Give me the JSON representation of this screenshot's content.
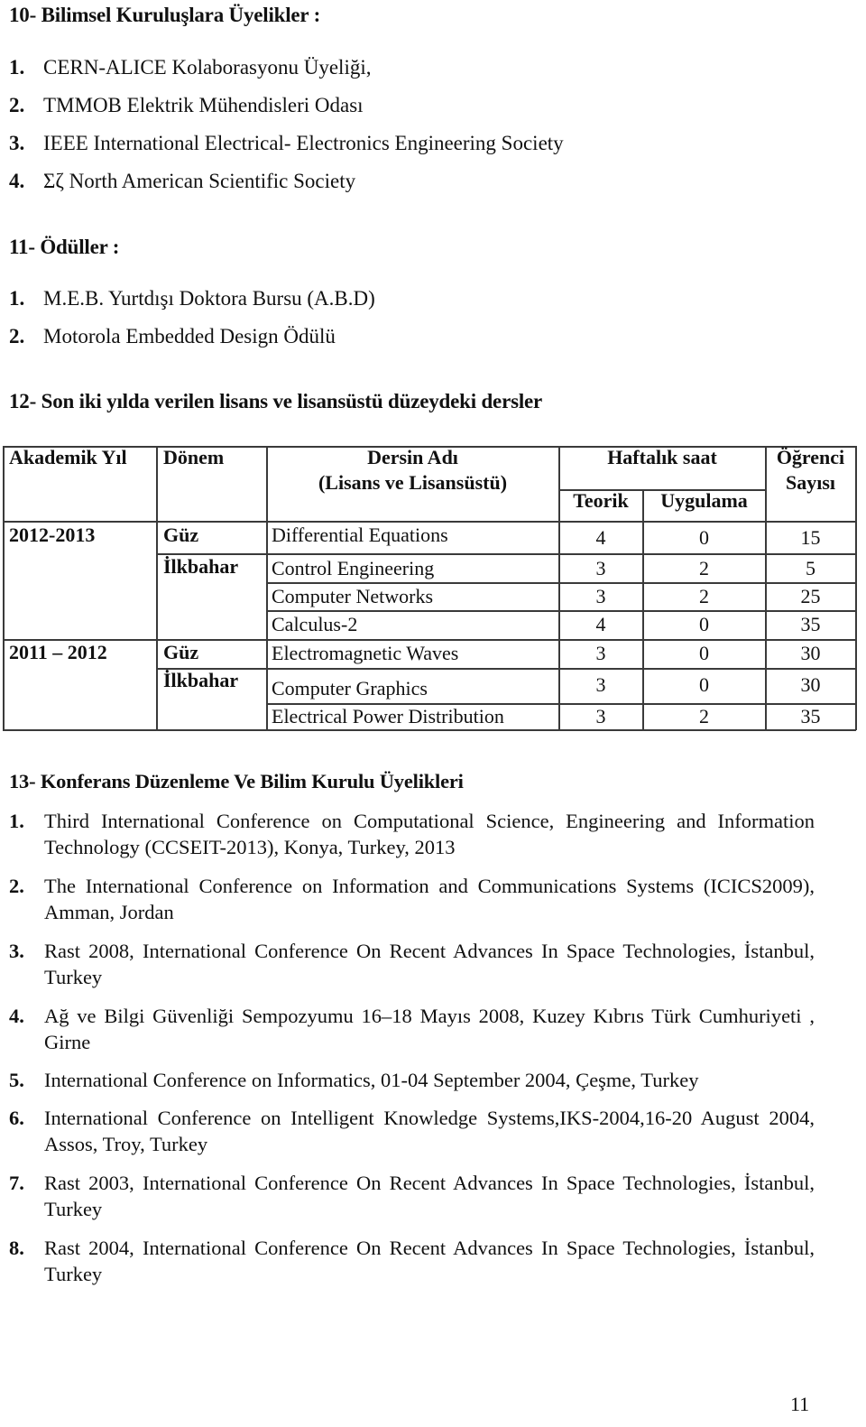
{
  "section10": {
    "heading": "10- Bilimsel Kuruluşlara Üyelikler :",
    "items": [
      {
        "num": "1.",
        "text": "CERN-ALICE Kolaborasyonu Üyeliği,"
      },
      {
        "num": "2.",
        "text": "TMMOB  Elektrik Mühendisleri Odası"
      },
      {
        "num": "3.",
        "text": "IEEE International Electrical- Electronics Engineering Society"
      },
      {
        "num": "4.",
        "text": "Σζ North American Scientific Society"
      }
    ]
  },
  "section11": {
    "heading": "11- Ödüller  :",
    "items": [
      {
        "num": "1.",
        "text": "M.E.B. Yurtdışı Doktora Bursu (A.B.D)"
      },
      {
        "num": "2.",
        "text": "Motorola Embedded Design Ödülü"
      }
    ]
  },
  "section12": {
    "heading": "12- Son iki yılda verilen lisans ve lisansüstü düzeydeki dersler",
    "table": {
      "headers": {
        "year": "Akademik Yıl",
        "term": "Dönem",
        "course_line1": "Dersin Adı",
        "course_line2": "(Lisans ve Lisansüstü)",
        "weekly": "Haftalık saat",
        "theory": "Teorik",
        "practice": "Uygulama",
        "students_line1": "Öğrenci",
        "students_line2": "Sayısı"
      },
      "year_groups": [
        {
          "year": "2012-2013",
          "terms": [
            "Güz",
            "İlkbahar"
          ]
        },
        {
          "year": "2011 – 2012",
          "terms": [
            "Güz",
            "İlkbahar"
          ]
        }
      ],
      "rows": [
        {
          "course": "Differential Equations",
          "theory": "4",
          "practice": "0",
          "students": "15"
        },
        {
          "course": "Control Engineering",
          "theory": "3",
          "practice": "2",
          "students": "5"
        },
        {
          "course": "Computer Networks",
          "theory": "3",
          "practice": "2",
          "students": "25"
        },
        {
          "course": "Calculus-2",
          "theory": "4",
          "practice": "0",
          "students": "35"
        },
        {
          "course": "Electromagnetic Waves",
          "theory": "3",
          "practice": "0",
          "students": "30"
        },
        {
          "course": "Computer Graphics",
          "theory": "3",
          "practice": "0",
          "students": "30"
        },
        {
          "course": "Electrical Power Distribution",
          "theory": "3",
          "practice": "2",
          "students": "35"
        }
      ]
    }
  },
  "section13": {
    "heading": "13- Konferans Düzenleme Ve Bilim  Kurulu Üyelikleri",
    "items": [
      {
        "num": "1.",
        "text": "Third International Conference on Computational Science, Engineering and Information Technology (CCSEIT-2013), Konya, Turkey, 2013"
      },
      {
        "num": "2.",
        "text": "The International Conference on Information and Communications Systems (ICICS2009), Amman, Jordan"
      },
      {
        "num": "3.",
        "text": "Rast 2008, International Conference On Recent Advances In Space Technologies, İstanbul, Turkey"
      },
      {
        "num": "4.",
        "text": "Ağ ve Bilgi Güvenliği Sempozyumu 16–18 Mayıs 2008, Kuzey Kıbrıs Türk Cumhuriyeti , Girne"
      },
      {
        "num": "5.",
        "text": "International Conference on Informatics, 01-04 September 2004, Çeşme, Turkey"
      },
      {
        "num": "6.",
        "text": "International Conference on Intelligent Knowledge Systems,IKS-2004,16-20 August 2004, Assos, Troy, Turkey"
      },
      {
        "num": "7.",
        "text": "Rast 2003, International Conference On Recent Advances In Space Technologies, İstanbul, Turkey"
      },
      {
        "num": "8.",
        "text": "Rast 2004, International Conference On Recent Advances In Space Technologies, İstanbul, Turkey"
      }
    ]
  },
  "footer": {
    "page_number": "11"
  }
}
